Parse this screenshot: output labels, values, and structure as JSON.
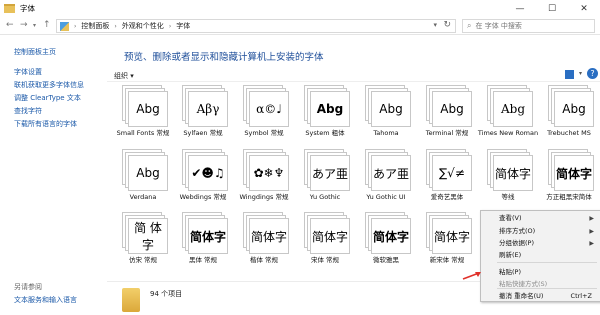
{
  "window": {
    "title": "字体",
    "minimize": "—",
    "maximize": "☐",
    "close": "✕"
  },
  "address": {
    "crumbs": [
      "控制面板",
      "外观和个性化",
      "字体"
    ],
    "search_placeholder": "在 字体 中搜索"
  },
  "sidebar": {
    "home": "控制面板主页",
    "items": [
      "字体设置",
      "联机获取更多字体信息",
      "调整 ClearType 文本",
      "查找字符",
      "下载所有语言的字体"
    ],
    "see_also": "另请参阅",
    "text_services": "文本服务和输入语言"
  },
  "main": {
    "heading": "预览、删除或者显示和隐藏计算机上安装的字体",
    "organize": "组织 ▾"
  },
  "fonts": [
    {
      "name": "Small Fonts 常规",
      "sample": "Abg"
    },
    {
      "name": "Sylfaen 常规",
      "sample": "Aβγ"
    },
    {
      "name": "Symbol 常规",
      "sample": "α©♩"
    },
    {
      "name": "System 粗体",
      "sample": "Abg"
    },
    {
      "name": "Tahoma",
      "sample": "Abg"
    },
    {
      "name": "Terminal 常规",
      "sample": "Abg"
    },
    {
      "name": "Times New Roman",
      "sample": "Abg"
    },
    {
      "name": "Trebuchet MS",
      "sample": "Abg"
    },
    {
      "name": "Verdana",
      "sample": "Abg"
    },
    {
      "name": "Webdings 常规",
      "sample": "✔☻♫"
    },
    {
      "name": "Wingdings 常规",
      "sample": "✿❄♆"
    },
    {
      "name": "Yu Gothic",
      "sample": "あア亜"
    },
    {
      "name": "Yu Gothic UI",
      "sample": "あア亜"
    },
    {
      "name": "爱奇艺黑体",
      "sample": "∑√≠"
    },
    {
      "name": "等线",
      "sample": "简体字"
    },
    {
      "name": "方正粗黑宋简体",
      "sample": "简体字"
    },
    {
      "name": "仿宋 常规",
      "sample": "简 体 字"
    },
    {
      "name": "黑体 常规",
      "sample": "简体字"
    },
    {
      "name": "楷体 常规",
      "sample": "简体字"
    },
    {
      "name": "宋体 常规",
      "sample": "简体字"
    },
    {
      "name": "微软雅黑",
      "sample": "简体字"
    },
    {
      "name": "新宋体 常规",
      "sample": "简体字"
    }
  ],
  "status": {
    "count": "94 个项目"
  },
  "context_menu": {
    "items": [
      {
        "label": "查看(V)",
        "submenu": true,
        "disabled": false
      },
      {
        "label": "排序方式(O)",
        "submenu": true,
        "disabled": false
      },
      {
        "label": "分组依据(P)",
        "submenu": true,
        "disabled": false
      },
      {
        "label": "刷新(E)",
        "submenu": false,
        "disabled": false
      },
      {
        "label": "粘贴(P)",
        "submenu": false,
        "disabled": false
      },
      {
        "label": "粘贴快捷方式(S)",
        "submenu": false,
        "disabled": true
      },
      {
        "label": "撤消 重命名(U)",
        "submenu": false,
        "disabled": false,
        "shortcut": "Ctrl+Z"
      }
    ]
  },
  "colors": {
    "link": "#1a58a8",
    "heading": "#1f4f9a",
    "arrow": "#e0312a"
  }
}
